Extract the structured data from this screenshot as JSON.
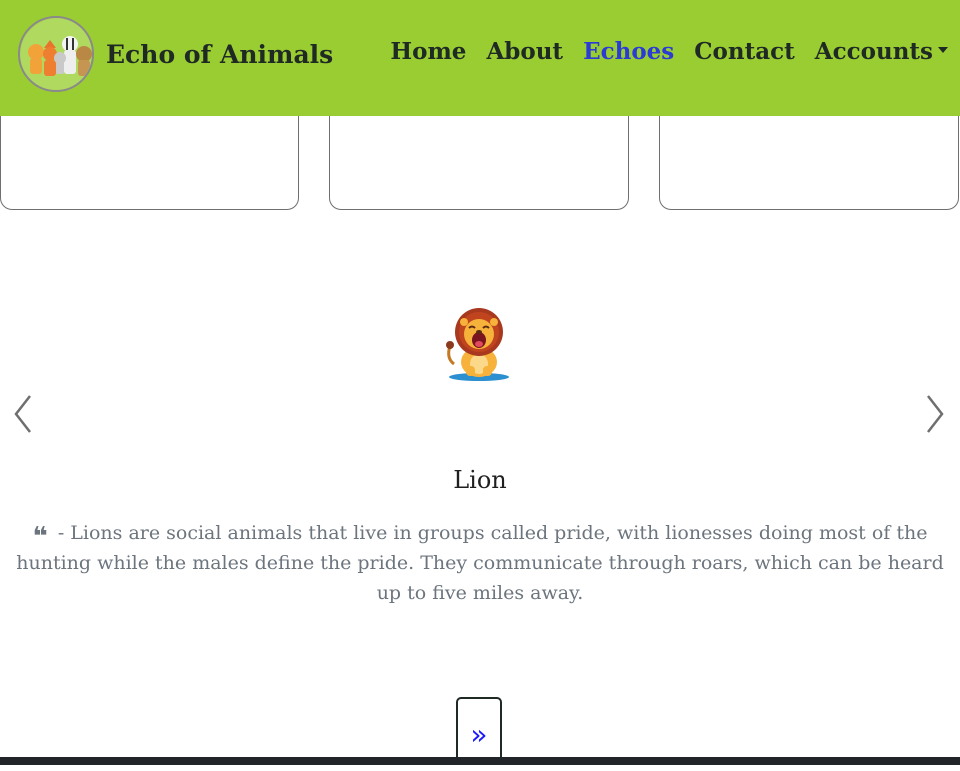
{
  "brand": {
    "name": "Echo of Animals",
    "logo_icon": "animal-group-logo"
  },
  "nav": {
    "items": [
      {
        "label": "Home"
      },
      {
        "label": "About"
      },
      {
        "label": "Echoes"
      },
      {
        "label": "Contact"
      },
      {
        "label": "Accounts"
      }
    ],
    "active": "Echoes"
  },
  "carousel": {
    "image_icon": "lion-icon",
    "title": "Lion",
    "quote_dash": "- ",
    "quote": "Lions are social animals that live in groups called pride, with lionesses doing most of the hunting while the males define the pride. They communicate through roars, which can be heard up to five miles away.",
    "prev_icon": "chevron-left-icon",
    "next_icon": "chevron-right-icon"
  },
  "pagination": {
    "next_label": "»"
  },
  "colors": {
    "navbar": "#9acd32",
    "brand_text": "#1f2a24",
    "active_link": "#2a3bd6",
    "quote_text": "#6c757d",
    "pager_link": "#1a1aff"
  }
}
